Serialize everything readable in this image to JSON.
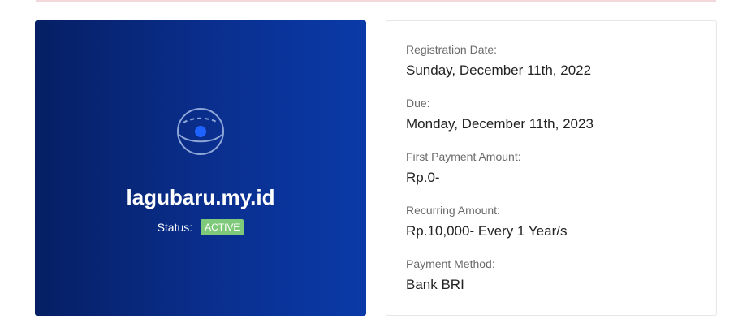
{
  "domain_card": {
    "icon": "domain-globe-icon",
    "domain_name": "lagubaru.my.id",
    "status_label": "Status:",
    "status_badge": "ACTIVE",
    "status_color": "#7fc97b",
    "gradient_start": "#061f64",
    "gradient_end": "#0a3aa8"
  },
  "details": {
    "registration_date_label": "Registration Date:",
    "registration_date": "Sunday, December 11th, 2022",
    "due_label": "Due:",
    "due": "Monday, December 11th, 2023",
    "first_payment_label": "First Payment Amount:",
    "first_payment": "Rp.0-",
    "recurring_label": "Recurring Amount:",
    "recurring": "Rp.10,000- Every 1 Year/s",
    "payment_method_label": "Payment Method:",
    "payment_method": "Bank BRI"
  }
}
